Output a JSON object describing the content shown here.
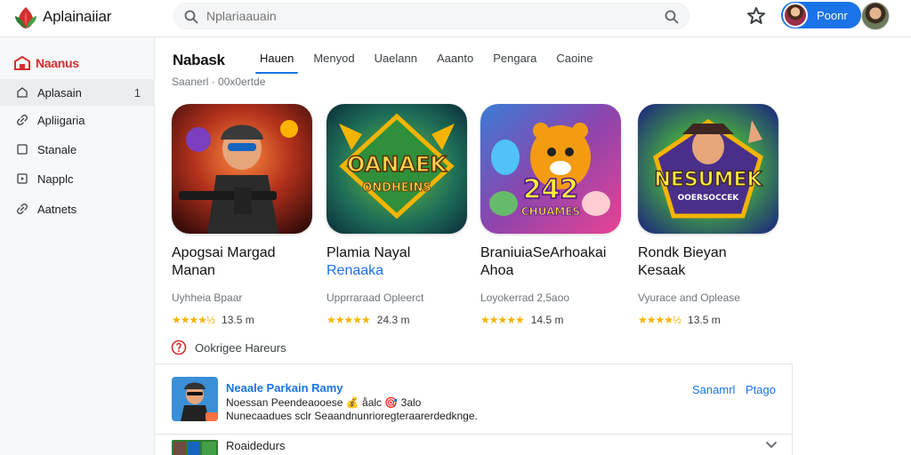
{
  "app": {
    "name": "Aplainaiiar"
  },
  "search": {
    "placeholder": "Nplariaauain"
  },
  "user": {
    "button_label": "Poonr"
  },
  "sidebar": {
    "title": "Naanus",
    "items": [
      {
        "label": "Aplasain",
        "count": "1",
        "icon": "home-outline-icon"
      },
      {
        "label": "Apliigaria",
        "count": "",
        "icon": "link-icon"
      },
      {
        "label": "Stanale",
        "count": "",
        "icon": "square-icon"
      },
      {
        "label": "Napplc",
        "count": "",
        "icon": "play-square-icon"
      },
      {
        "label": "Aatnets",
        "count": "",
        "icon": "link-icon"
      }
    ]
  },
  "main": {
    "section_title": "Nabask",
    "subtitle": "Saanerl ·  00x0ertde",
    "tabs": [
      {
        "label": "Hauen",
        "active": true
      },
      {
        "label": "Menyod",
        "active": false
      },
      {
        "label": "Uaelann",
        "active": false
      },
      {
        "label": "Aaanto",
        "active": false
      },
      {
        "label": "Pengara",
        "active": false
      },
      {
        "label": "Caoine",
        "active": false
      }
    ],
    "cards": [
      {
        "title_line1": "Apogsai Margad",
        "title_line2": "Manan",
        "developer": "Uyhheia  Bpaar",
        "rating": "★★★★½",
        "size": "13.5 m",
        "thumb_text": ""
      },
      {
        "title_line1": "Plamia Nayal",
        "title_line2": "Renaaka",
        "developer": "Upprraraad Opleerct",
        "rating": "★★★★★",
        "size": "24.3 m",
        "thumb_text_1": "OANAEK",
        "thumb_text_2": "ONDHEINS"
      },
      {
        "title_line1": "BraniuiaSeArhoakai",
        "title_line2": "Ahoa",
        "developer": "Loyokerrad 2,5aoo",
        "rating": "★★★★★",
        "size": "14.5 m",
        "thumb_text_1": "242",
        "thumb_text_2": "CHUAMES"
      },
      {
        "title_line1": "Rondk Bieyan",
        "title_line2": "Kesaak",
        "developer": "Vyurace and Oplease",
        "rating": "★★★★½",
        "size": "13.5 m",
        "thumb_text_1": "NESUMEK",
        "thumb_text_2": "OOERSOCCEK"
      }
    ],
    "more_label": "Ookrigee  Hareurs"
  },
  "list": {
    "row1": {
      "title": "Neaale Parkain Ramy",
      "meta": "Noessan Peendeaooese  💰 åalc  🎯 3alo",
      "description": "Nunecaadues sclr Seaandnunrioregteraarerdedknge.",
      "link1": "Sanamrl",
      "link2": "Ptago"
    },
    "row2": {
      "title": "Roaidedurs"
    }
  },
  "colors": {
    "accent": "#1a73e8",
    "brand_red": "#d32f2f",
    "star": "#f4b400",
    "sidebar_bg": "#f7f8f9"
  }
}
